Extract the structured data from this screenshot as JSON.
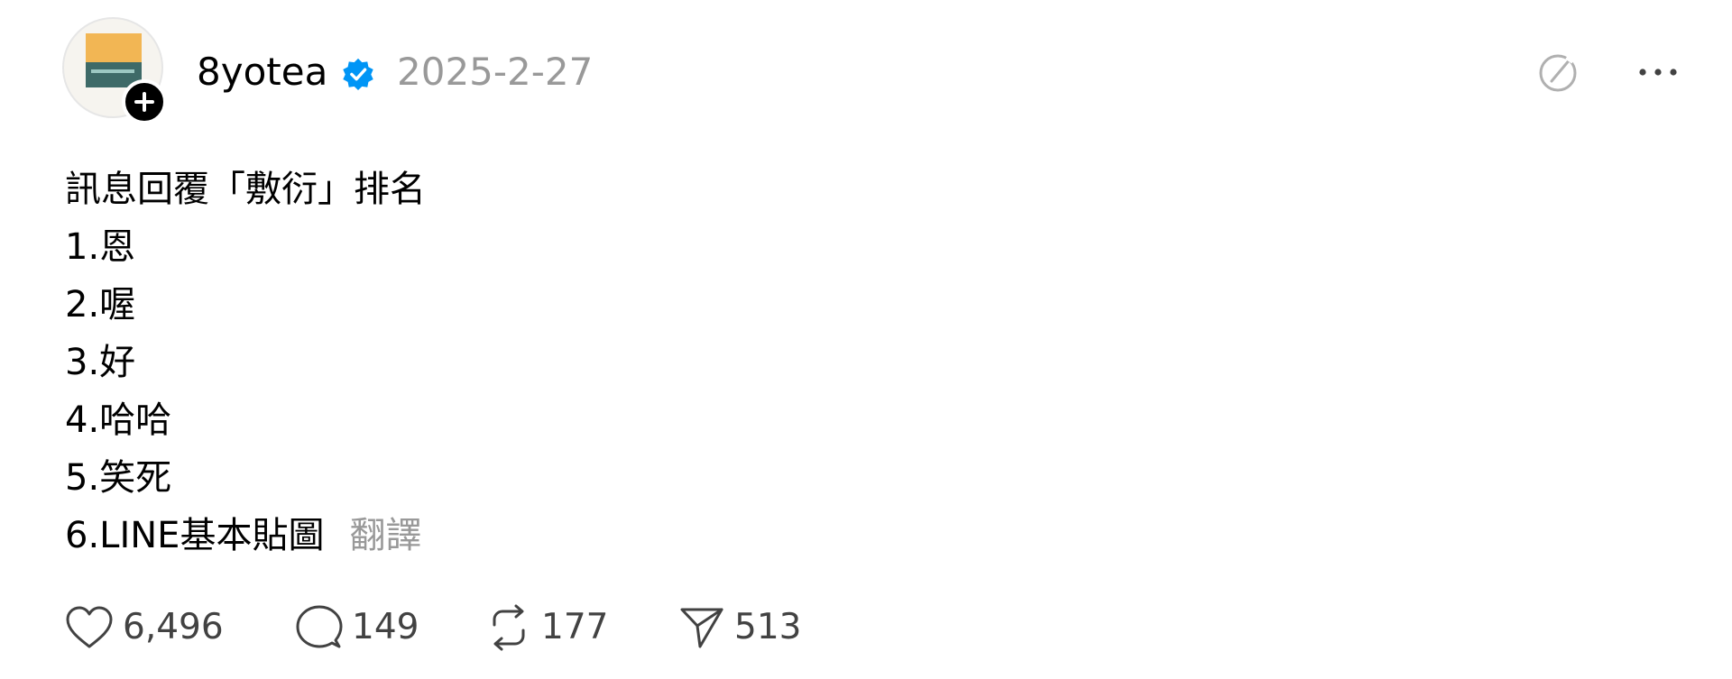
{
  "post": {
    "username": "8yotea",
    "timestamp": "2025-2-27",
    "content_lines": [
      "訊息回覆「敷衍」排名",
      "1.恩",
      "2.喔",
      "3.好",
      "4.哈哈",
      "5.笑死",
      "6.LINE基本貼圖"
    ],
    "translate_label": "翻譯",
    "stats": {
      "likes": "6,496",
      "comments": "149",
      "reposts": "177",
      "shares": "513"
    }
  },
  "icons": {
    "verified": "verified-badge-icon",
    "follow": "plus-icon",
    "edit": "edit-icon",
    "more": "more-icon",
    "like": "heart-icon",
    "comment": "comment-icon",
    "repost": "repost-icon",
    "share": "send-icon"
  },
  "colors": {
    "verified": "#0095f6",
    "muted": "#999999",
    "text": "#000000",
    "stat_text": "#424242"
  }
}
